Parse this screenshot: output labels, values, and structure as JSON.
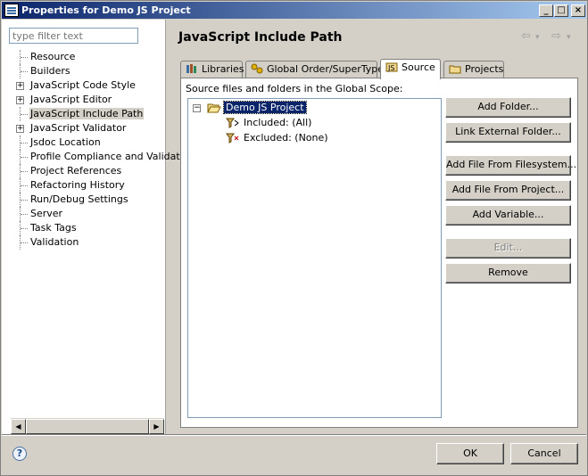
{
  "window": {
    "title": "Properties for Demo JS Project",
    "controls": [
      "_",
      "□",
      "×"
    ]
  },
  "filter": {
    "placeholder": "type filter text",
    "value": ""
  },
  "tree": [
    {
      "label": "Resource",
      "expandable": false
    },
    {
      "label": "Builders",
      "expandable": false
    },
    {
      "label": "JavaScript Code Style",
      "expandable": true
    },
    {
      "label": "JavaScript Editor",
      "expandable": true
    },
    {
      "label": "JavaScript Include Path",
      "expandable": false,
      "selected": true
    },
    {
      "label": "JavaScript Validator",
      "expandable": true
    },
    {
      "label": "Jsdoc Location",
      "expandable": false
    },
    {
      "label": "Profile Compliance and Validatio",
      "expandable": false
    },
    {
      "label": "Project References",
      "expandable": false
    },
    {
      "label": "Refactoring History",
      "expandable": false
    },
    {
      "label": "Run/Debug Settings",
      "expandable": false
    },
    {
      "label": "Server",
      "expandable": false
    },
    {
      "label": "Task Tags",
      "expandable": false
    },
    {
      "label": "Validation",
      "expandable": false
    }
  ],
  "page": {
    "title": "JavaScript Include Path",
    "back_arrow": "⇦",
    "forward_arrow": "⇨",
    "dropdown": "▾"
  },
  "tabs": [
    {
      "label": "Libraries",
      "icon": "libraries-icon"
    },
    {
      "label": "Global Order/SuperType",
      "icon": "order-icon"
    },
    {
      "label": "Source",
      "icon": "source-icon",
      "active": true
    },
    {
      "label": "Projects",
      "icon": "projects-icon"
    }
  ],
  "source": {
    "scope_label": "Source files and folders in the Global Scope:",
    "project": "Demo JS Project",
    "included": "Included: (All)",
    "excluded": "Excluded: (None)"
  },
  "buttons": {
    "add_folder": "Add Folder...",
    "link_external": "Link External Folder...",
    "add_file_fs": "Add File From Filesystem...",
    "add_file_project": "Add File From Project...",
    "add_variable": "Add Variable...",
    "edit": "Edit...",
    "remove": "Remove"
  },
  "footer": {
    "help": "?",
    "ok": "OK",
    "cancel": "Cancel"
  },
  "colors": {
    "title_start": "#0a246a",
    "title_end": "#a6caf0",
    "selection": "#0a246a",
    "face": "#d4d0c8"
  }
}
